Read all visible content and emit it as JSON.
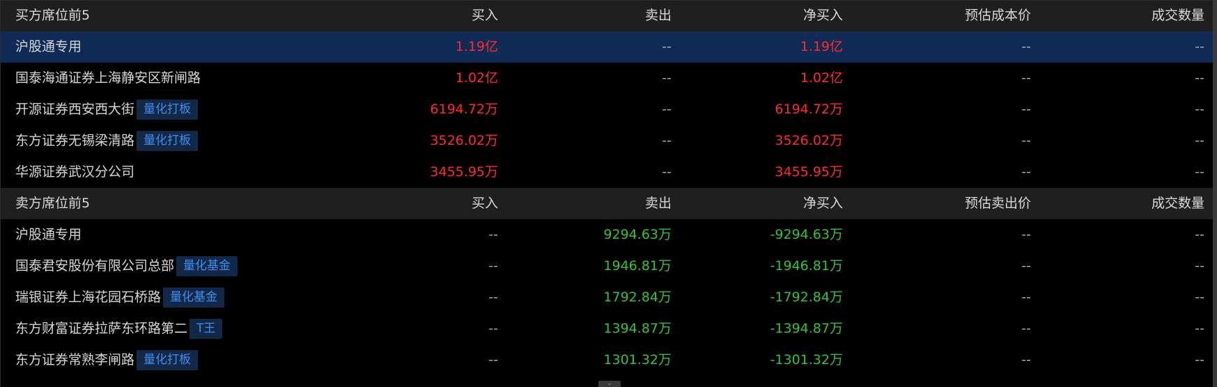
{
  "buy_section": {
    "headers": [
      "买方席位前5",
      "买入",
      "卖出",
      "净买入",
      "预估成本价",
      "成交数量"
    ],
    "rows": [
      {
        "name": "沪股通专用",
        "tag": "",
        "buy": "1.19亿",
        "sell": "--",
        "net": "1.19亿",
        "price": "--",
        "volume": "--"
      },
      {
        "name": "国泰海通证券上海静安区新闸路",
        "tag": "",
        "buy": "1.02亿",
        "sell": "--",
        "net": "1.02亿",
        "price": "--",
        "volume": "--"
      },
      {
        "name": "开源证券西安西大街",
        "tag": "量化打板",
        "buy": "6194.72万",
        "sell": "--",
        "net": "6194.72万",
        "price": "--",
        "volume": "--"
      },
      {
        "name": "东方证券无锡梁清路",
        "tag": "量化打板",
        "buy": "3526.02万",
        "sell": "--",
        "net": "3526.02万",
        "price": "--",
        "volume": "--"
      },
      {
        "name": "华源证券武汉分公司",
        "tag": "",
        "buy": "3455.95万",
        "sell": "--",
        "net": "3455.95万",
        "price": "--",
        "volume": "--"
      }
    ]
  },
  "sell_section": {
    "headers": [
      "卖方席位前5",
      "买入",
      "卖出",
      "净买入",
      "预估卖出价",
      "成交数量"
    ],
    "rows": [
      {
        "name": "沪股通专用",
        "tag": "",
        "buy": "--",
        "sell": "9294.63万",
        "net": "-9294.63万",
        "price": "--",
        "volume": "--"
      },
      {
        "name": "国泰君安股份有限公司总部",
        "tag": "量化基金",
        "buy": "--",
        "sell": "1946.81万",
        "net": "-1946.81万",
        "price": "--",
        "volume": "--"
      },
      {
        "name": "瑞银证券上海花园石桥路",
        "tag": "量化基金",
        "buy": "--",
        "sell": "1792.84万",
        "net": "-1792.84万",
        "price": "--",
        "volume": "--"
      },
      {
        "name": "东方财富证券拉萨东环路第二",
        "tag": "T王",
        "buy": "--",
        "sell": "1394.87万",
        "net": "-1394.87万",
        "price": "--",
        "volume": "--"
      },
      {
        "name": "东方证券常熟李闸路",
        "tag": "量化打板",
        "buy": "--",
        "sell": "1301.32万",
        "net": "-1301.32万",
        "price": "--",
        "volume": "--"
      }
    ]
  },
  "colors": {
    "up": "#ff2b2b",
    "down": "#2fc43c",
    "selected_row": "#0e2a55",
    "tag_text": "#3d8ef0"
  },
  "selected_row": "buy_section.rows.0",
  "collapse_icon": "chevron-down-icon"
}
